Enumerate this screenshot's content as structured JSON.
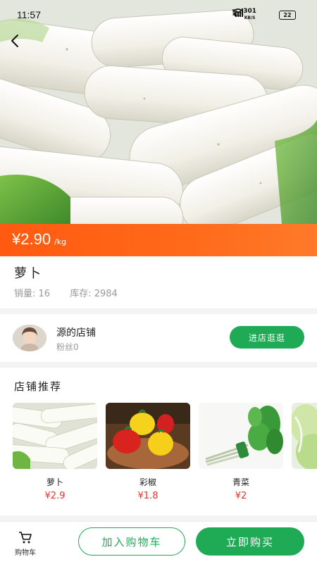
{
  "status_bar": {
    "time": "11:57",
    "network_speed": "301\nKB/S",
    "signal1": "5G",
    "signal2": "5G",
    "battery": "22"
  },
  "product": {
    "price": "¥2.90",
    "unit": "/kg",
    "name": "萝卜",
    "sales_label": "销量: 16",
    "stock_label": "库存: 2984"
  },
  "shop": {
    "name": "源的店铺",
    "fans": "粉丝0",
    "enter_label": "进店逛逛"
  },
  "recommend": {
    "title": "店铺推荐",
    "items": [
      {
        "name": "萝卜",
        "price": "¥2.9"
      },
      {
        "name": "彩椒",
        "price": "¥1.8"
      },
      {
        "name": "青菜",
        "price": "¥2"
      }
    ]
  },
  "bottom_bar": {
    "cart_label": "购物车",
    "add_to_cart_label": "加入购物车",
    "buy_now_label": "立即购买"
  },
  "colors": {
    "accent_green": "#1faa55",
    "price_orange": "#ff5a10",
    "price_red": "#e5322d"
  }
}
